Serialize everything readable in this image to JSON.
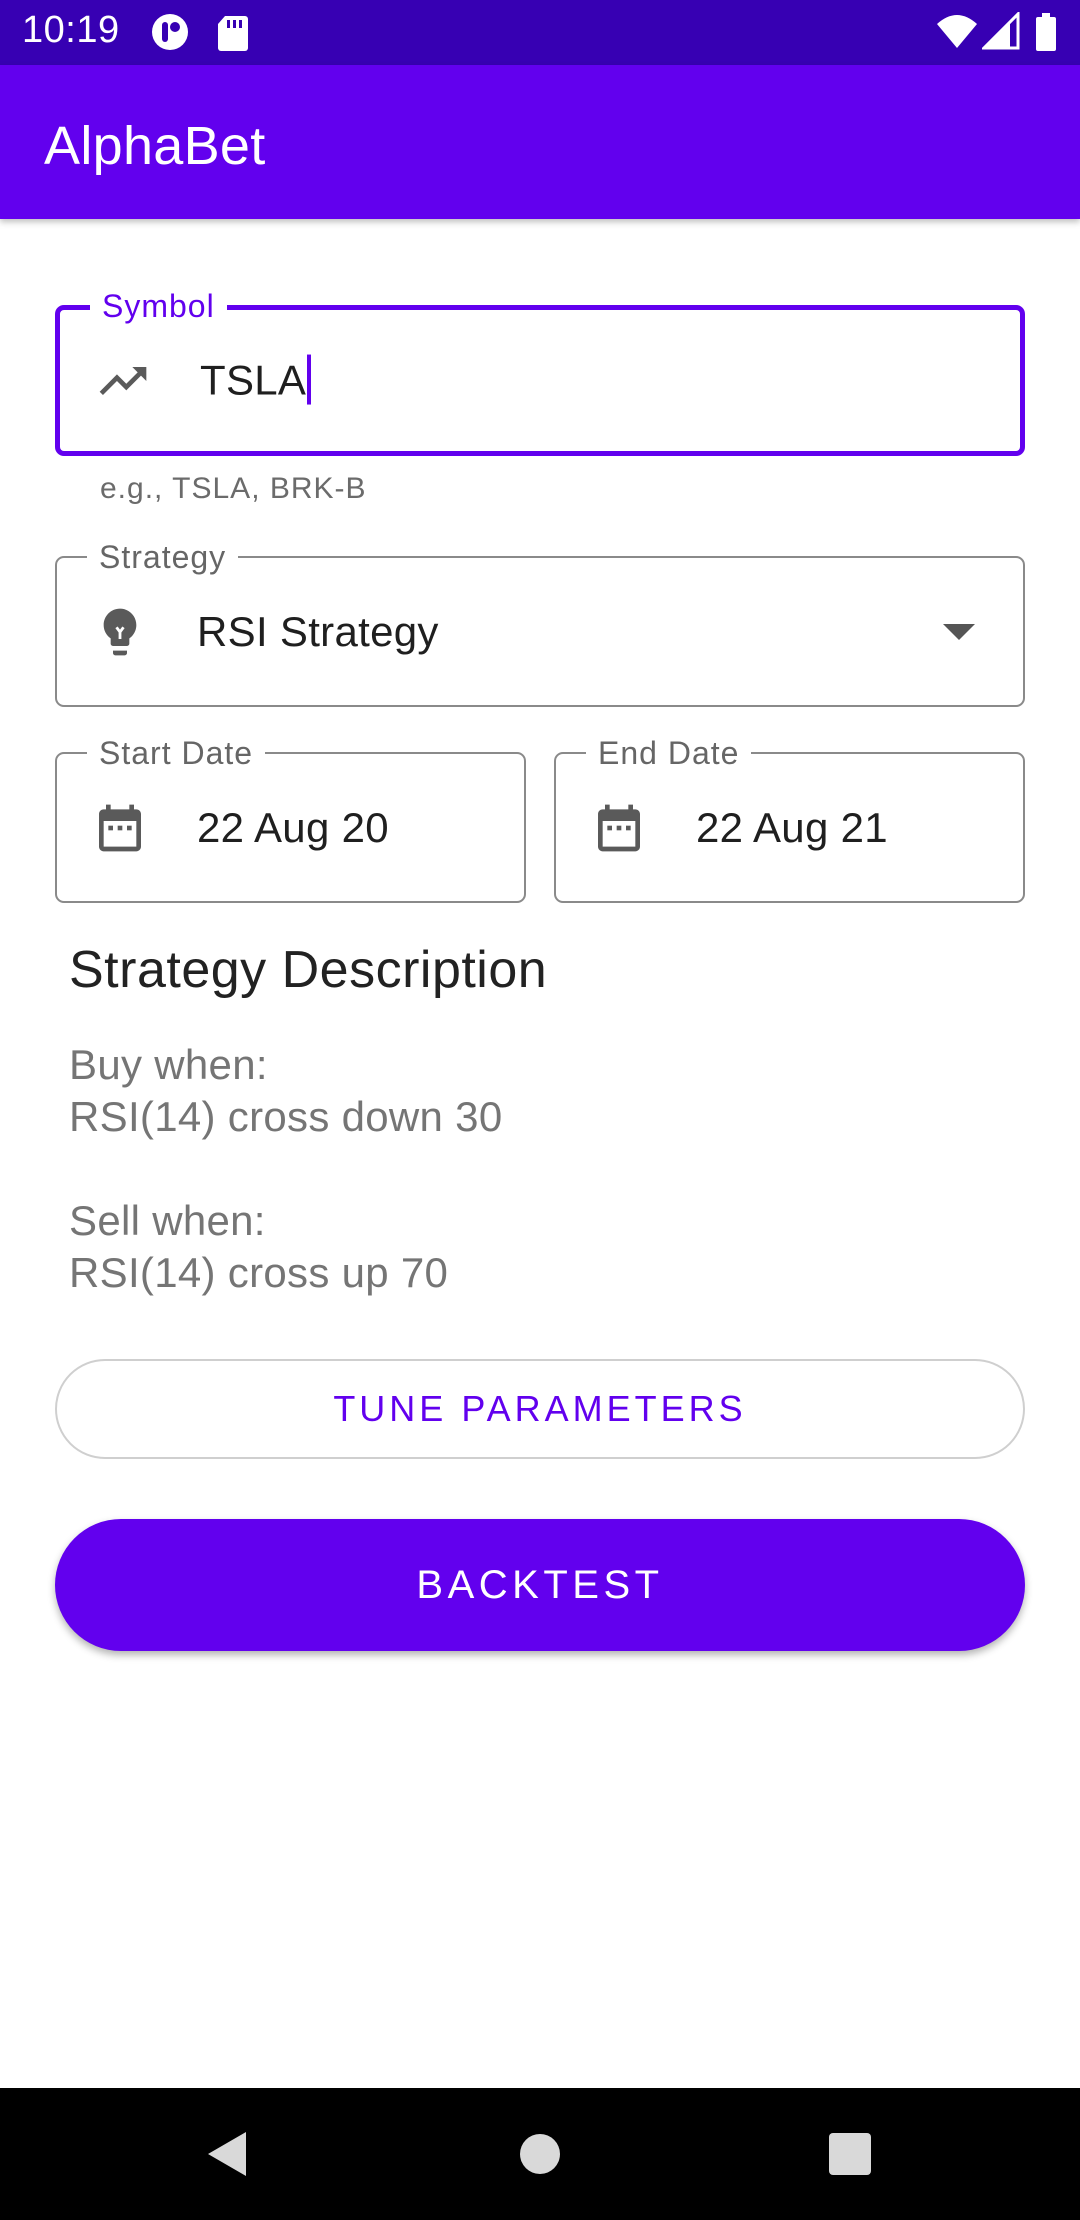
{
  "status_bar": {
    "time": "10:19",
    "left_icons": [
      "app-notification-icon",
      "sd-card-icon"
    ],
    "right_icons": [
      "wifi-icon",
      "cell-signal-icon",
      "battery-icon"
    ]
  },
  "app_bar": {
    "title": "AlphaBet"
  },
  "form": {
    "symbol": {
      "label": "Symbol",
      "value": "TSLA",
      "helper": "e.g., TSLA, BRK-B",
      "icon": "trending-up-icon"
    },
    "strategy": {
      "label": "Strategy",
      "value": "RSI Strategy",
      "icon": "lightbulb-icon"
    },
    "start_date": {
      "label": "Start Date",
      "value": "22 Aug 20",
      "icon": "calendar-icon"
    },
    "end_date": {
      "label": "End Date",
      "value": "22 Aug 21",
      "icon": "calendar-icon"
    }
  },
  "description": {
    "title": "Strategy Description",
    "buy_heading": "Buy when:",
    "buy_rule": "RSI(14) cross down 30",
    "sell_heading": "Sell when:",
    "sell_rule": "RSI(14) cross up 70"
  },
  "buttons": {
    "tune": "TUNE PARAMETERS",
    "backtest": "BACKTEST"
  },
  "colors": {
    "primary": "#6200ee",
    "primary_dark": "#3700b3"
  }
}
